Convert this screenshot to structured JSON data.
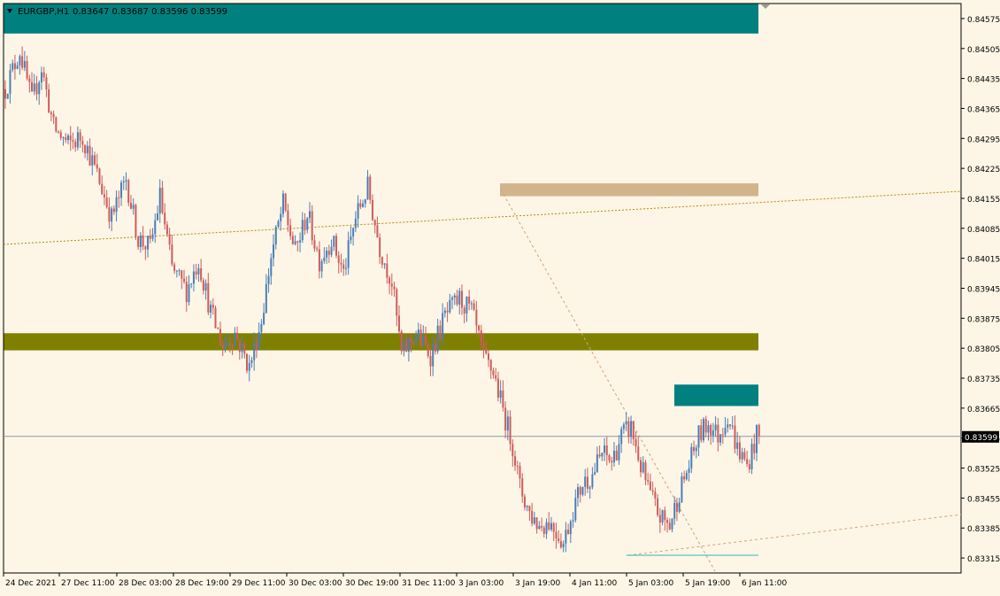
{
  "header": {
    "symbol_label": "EURGBP,H1",
    "ohlc_label": "0.83647 0.83687 0.83596 0.83599"
  },
  "colors": {
    "background": "#fdf6e6",
    "bull": "#4a7eb5",
    "bear": "#cd5c5c",
    "zone_teal": "#00807f",
    "zone_olive": "#808000",
    "zone_tan": "#d2b48c",
    "axis_text": "#000000",
    "trendline": "#b8860b"
  },
  "chart_data": {
    "type": "candlestick",
    "symbol": "EURGBP",
    "timeframe": "H1",
    "last_price": 0.83599,
    "last_price_label": "0.83599",
    "ylim": [
      0.8328,
      0.8461
    ],
    "y_ticks": [
      "0.84575",
      "0.84505",
      "0.84435",
      "0.84365",
      "0.84295",
      "0.84225",
      "0.84155",
      "0.84085",
      "0.84015",
      "0.83945",
      "0.83875",
      "0.83805",
      "0.83735",
      "0.83665",
      "0.83595",
      "0.83525",
      "0.83455",
      "0.83385",
      "0.83315"
    ],
    "x_ticks": [
      "24 Dec 2021",
      "27 Dec 11:00",
      "28 Dec 03:00",
      "28 Dec 19:00",
      "29 Dec 11:00",
      "30 Dec 03:00",
      "30 Dec 19:00",
      "31 Dec 11:00",
      "3 Jan 03:00",
      "3 Jan 19:00",
      "4 Jan 11:00",
      "5 Jan 03:00",
      "5 Jan 19:00",
      "6 Jan 11:00"
    ],
    "path": [
      [
        0,
        0.8441
      ],
      [
        6,
        0.845
      ],
      [
        11,
        0.8438
      ],
      [
        15,
        0.8446
      ],
      [
        20,
        0.8432
      ],
      [
        26,
        0.8428
      ],
      [
        32,
        0.843
      ],
      [
        38,
        0.8421
      ],
      [
        44,
        0.8411
      ],
      [
        50,
        0.842
      ],
      [
        55,
        0.8406
      ],
      [
        60,
        0.8404
      ],
      [
        64,
        0.8416
      ],
      [
        69,
        0.8399
      ],
      [
        75,
        0.8394
      ],
      [
        80,
        0.8401
      ],
      [
        85,
        0.8389
      ],
      [
        90,
        0.8381
      ],
      [
        95,
        0.8384
      ],
      [
        101,
        0.8376
      ],
      [
        106,
        0.8387
      ],
      [
        110,
        0.8402
      ],
      [
        115,
        0.8414
      ],
      [
        120,
        0.8403
      ],
      [
        125,
        0.8412
      ],
      [
        130,
        0.8401
      ],
      [
        135,
        0.8406
      ],
      [
        140,
        0.8398
      ],
      [
        145,
        0.8411
      ],
      [
        150,
        0.8418
      ],
      [
        155,
        0.8404
      ],
      [
        160,
        0.8396
      ],
      [
        164,
        0.8379
      ],
      [
        170,
        0.8384
      ],
      [
        176,
        0.8379
      ],
      [
        182,
        0.8388
      ],
      [
        188,
        0.8392
      ],
      [
        193,
        0.8389
      ],
      [
        198,
        0.8378
      ],
      [
        202,
        0.8375
      ],
      [
        206,
        0.8366
      ],
      [
        210,
        0.8358
      ],
      [
        213,
        0.8348
      ],
      [
        217,
        0.8342
      ],
      [
        221,
        0.8339
      ],
      [
        225,
        0.834
      ],
      [
        229,
        0.8337
      ],
      [
        231,
        0.8335
      ],
      [
        235,
        0.8343
      ],
      [
        239,
        0.8349
      ],
      [
        243,
        0.8351
      ],
      [
        247,
        0.8356
      ],
      [
        251,
        0.8354
      ],
      [
        255,
        0.836
      ],
      [
        259,
        0.8362
      ],
      [
        263,
        0.8353
      ],
      [
        267,
        0.8346
      ],
      [
        271,
        0.8341
      ],
      [
        275,
        0.8339
      ],
      [
        279,
        0.8347
      ],
      [
        283,
        0.8353
      ],
      [
        287,
        0.836
      ],
      [
        291,
        0.8363
      ],
      [
        295,
        0.836
      ],
      [
        299,
        0.8365
      ],
      [
        303,
        0.8357
      ],
      [
        307,
        0.8353
      ],
      [
        311,
        0.836
      ]
    ],
    "zones": [
      {
        "name": "top-supply",
        "top": 0.8461,
        "bottom": 0.8454,
        "color": "teal"
      },
      {
        "name": "supply-tan",
        "top": 0.8419,
        "bottom": 0.8416,
        "color": "tan"
      },
      {
        "name": "mid-zone",
        "top": 0.8384,
        "bottom": 0.838,
        "color": "olive"
      },
      {
        "name": "right-supply",
        "top": 0.8372,
        "bottom": 0.8367,
        "color": "teal"
      }
    ]
  }
}
